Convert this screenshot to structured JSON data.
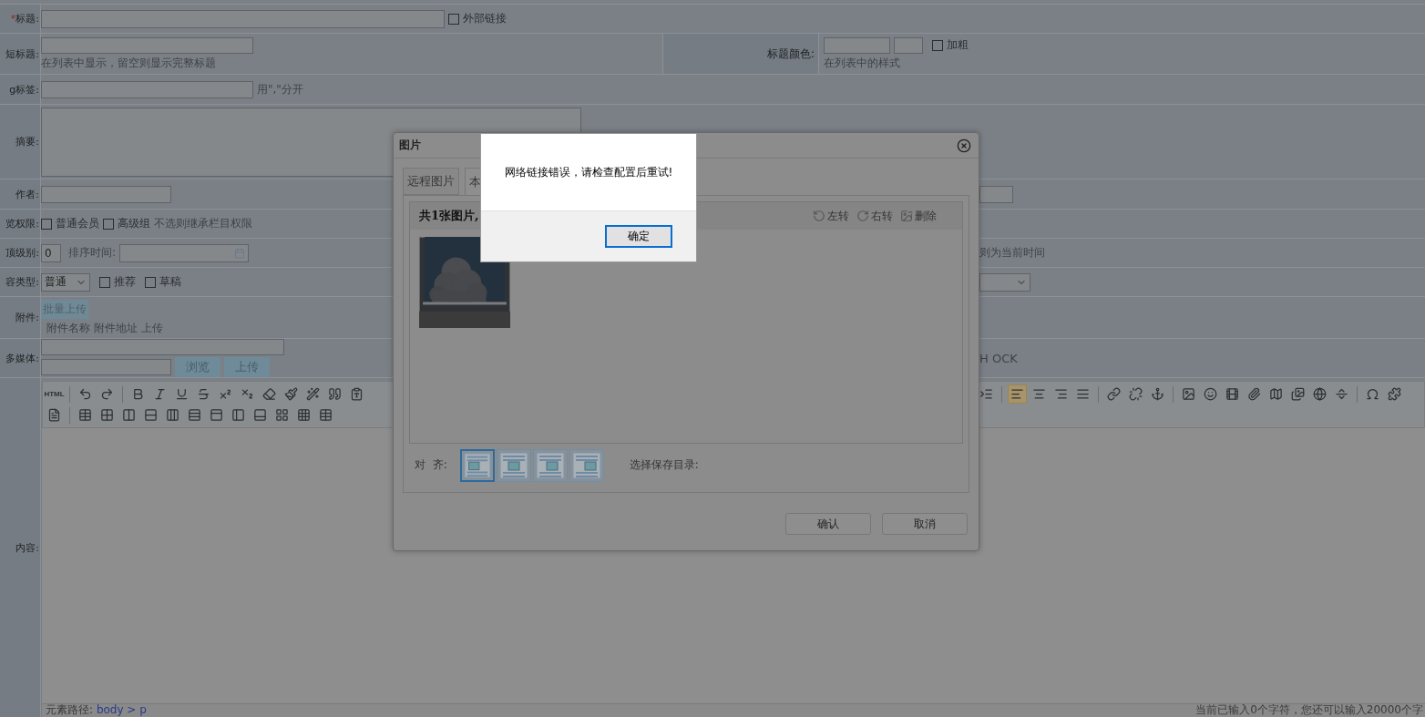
{
  "title_row": {
    "required_mark": "*",
    "label": "标题:",
    "external_link": {
      "label": "外部链接",
      "checked": false
    }
  },
  "short_title_row": {
    "label": "短标题:",
    "hint": "在列表中显示，留空则显示完整标题",
    "color_label": "标题颜色:",
    "bold": {
      "label": "加粗",
      "checked": false
    },
    "color_hint": "在列表中的样式"
  },
  "tag_row": {
    "label": "g标签:",
    "hint": "用\",\"分开"
  },
  "summary_row": {
    "label": "摘要:"
  },
  "author_row": {
    "label": "作者:"
  },
  "permission_row": {
    "label": "览权限:",
    "options": [
      {
        "label": "普通会员",
        "checked": false
      },
      {
        "label": "高级组",
        "checked": false
      }
    ],
    "hint": "不选则继承栏目权限"
  },
  "level_row": {
    "label": "顶级别:",
    "level_value": "0",
    "sort_time_label": "排序时间:",
    "right_hint": "则为当前时间"
  },
  "type_row": {
    "label": "容类型:",
    "type_value": "普通",
    "options": [
      {
        "label": "推荐",
        "checked": false
      },
      {
        "label": "草稿",
        "checked": false
      }
    ]
  },
  "attachment_row": {
    "label": "附件:",
    "batch_upload": "批量上传",
    "columns": [
      "附件名称",
      "附件地址",
      "上传"
    ]
  },
  "media_row": {
    "label": "多媒体:",
    "browse": "浏览",
    "upload": "上传",
    "right_text": "H OCK"
  },
  "content_row": {
    "label": "内容:",
    "html_button": "HTML",
    "alignment": [
      {
        "selected": true
      },
      {
        "selected": false
      },
      {
        "selected": false
      },
      {
        "selected": false
      }
    ],
    "path_label": "元素路径:",
    "path": "body > p",
    "counter": "当前已输入0个字符，您还可以输入20000个字"
  },
  "image_dialog": {
    "title": "图片",
    "tabs": [
      {
        "label": "远程图片",
        "selected": false
      },
      {
        "label": "本",
        "selected": true
      }
    ],
    "summary": "共1张图片,",
    "actions": [
      "左转",
      "右转",
      "删除"
    ],
    "align_label": "对  齐:",
    "align_options": [
      {
        "selected": true
      },
      {
        "selected": false
      },
      {
        "selected": false
      },
      {
        "selected": false
      }
    ],
    "save_dir_label": "选择保存目录:",
    "buttons": [
      "确认",
      "取消"
    ]
  },
  "alert": {
    "message": "网络链接错误，请检查配置后重试!",
    "ok": "确定"
  }
}
